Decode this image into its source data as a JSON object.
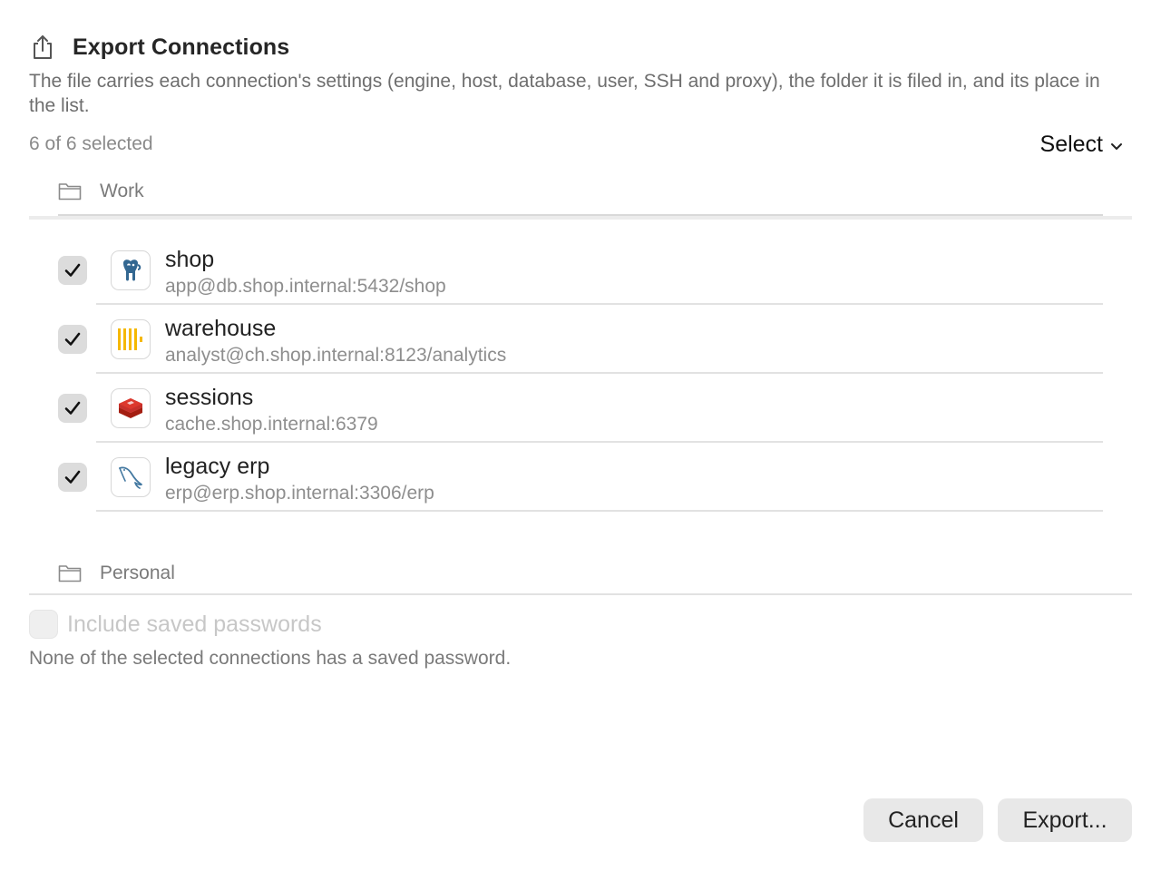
{
  "dialog": {
    "title": "Export Connections",
    "description": "The file carries each connection's settings (engine, host, database, user, SSH and proxy), the folder it is filed in, and its place in the list.",
    "selection_count": "6 of 6 selected",
    "select_menu_label": "Select"
  },
  "folders": [
    {
      "label": "Work",
      "connections": [
        {
          "name": "shop",
          "detail": "app@db.shop.internal:5432/shop",
          "icon": "postgresql-icon",
          "checked": true
        },
        {
          "name": "warehouse",
          "detail": "analyst@ch.shop.internal:8123/analytics",
          "icon": "clickhouse-icon",
          "checked": true
        },
        {
          "name": "sessions",
          "detail": "cache.shop.internal:6379",
          "icon": "redis-icon",
          "checked": true
        },
        {
          "name": "legacy erp",
          "detail": "erp@erp.shop.internal:3306/erp",
          "icon": "mysql-icon",
          "checked": true
        }
      ]
    },
    {
      "label": "Personal"
    }
  ],
  "passwords": {
    "label": "Include saved passwords",
    "enabled": false,
    "note": "None of the selected connections has a saved password."
  },
  "buttons": {
    "cancel": "Cancel",
    "export": "Export..."
  },
  "colors": {
    "postgres_blue": "#336791",
    "clickhouse_yellow": "#f5b800",
    "redis_red": "#c6302b",
    "mysql_blue": "#4479a1"
  }
}
